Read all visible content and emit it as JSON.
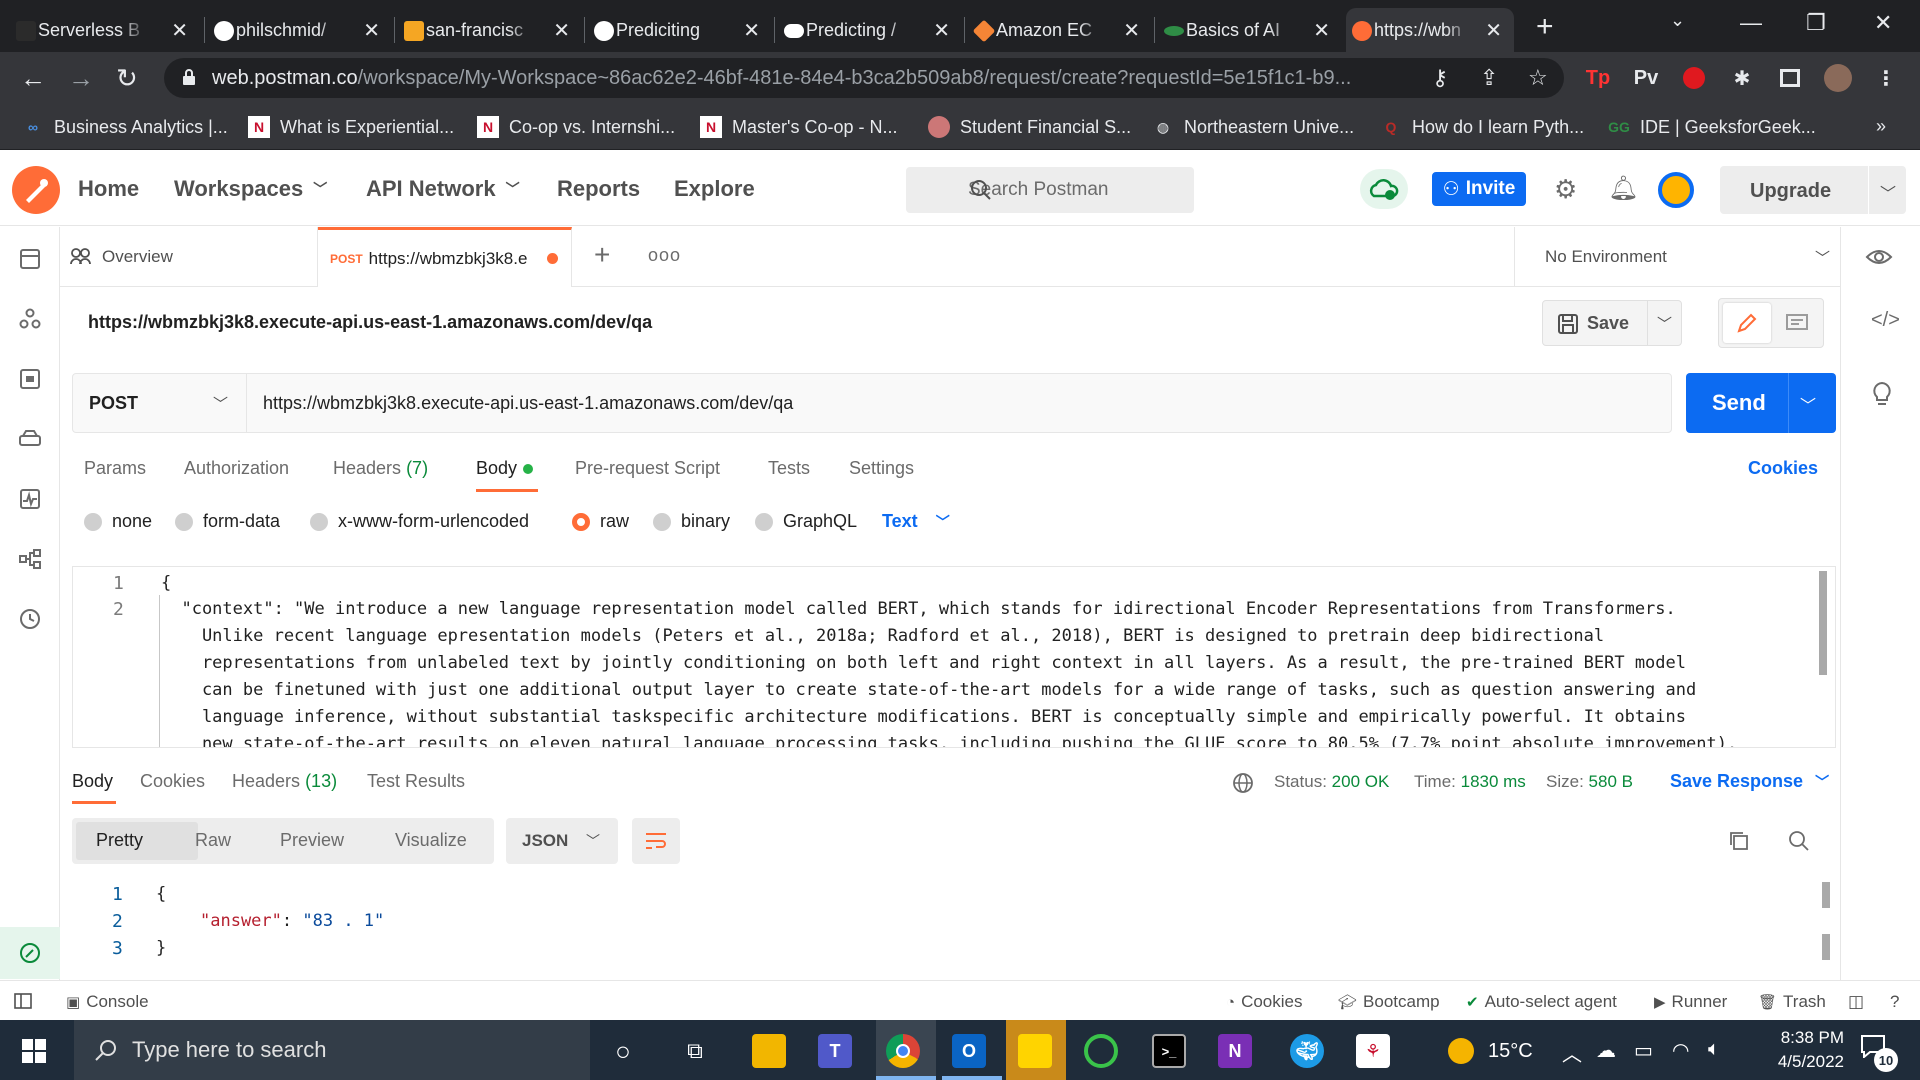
{
  "browser": {
    "tabs": [
      {
        "label": "Serverless B",
        "icon": "serverless-icon",
        "color": "#e04b26"
      },
      {
        "label": "philschmid/",
        "icon": "github-icon",
        "color": "#ffffff"
      },
      {
        "label": "san-francisc",
        "icon": "book-icon",
        "color": "#f5a623"
      },
      {
        "label": "Prediciting",
        "icon": "github-icon",
        "color": "#ffffff"
      },
      {
        "label": "Predicting /",
        "icon": "medium-icon",
        "color": "#ffffff"
      },
      {
        "label": "Amazon EC",
        "icon": "aws-cube-icon",
        "color": "#f58536"
      },
      {
        "label": "Basics of AI",
        "icon": "geeksforgeeks-icon",
        "color": "#2f8d46"
      },
      {
        "label": "https://wbn",
        "icon": "postman-icon",
        "color": "#ff6c37",
        "active": true
      }
    ],
    "address": {
      "host": "web.postman.co",
      "path": "/workspace/My-Workspace~86ac62e2-46bf-481e-84e4-b3ca2b509ab8/request/create?requestId=5e15f1c1-b9..."
    },
    "extensions": [
      "Tp",
      "Pv"
    ],
    "bookmarks": [
      {
        "label": "Business Analytics |...",
        "icon": "infinity-icon"
      },
      {
        "label": "What is Experiential...",
        "icon": "northeastern-icon"
      },
      {
        "label": "Co-op vs. Internshi...",
        "icon": "northeastern-icon"
      },
      {
        "label": "Master's Co-op - N...",
        "icon": "northeastern-icon"
      },
      {
        "label": "Student Financial S...",
        "icon": "seal-icon"
      },
      {
        "label": "Northeastern Unive...",
        "icon": "globe-icon"
      },
      {
        "label": "How do I learn Pyth...",
        "icon": "quora-icon"
      },
      {
        "label": "IDE | GeeksforGeek...",
        "icon": "geeksforgeeks-icon"
      }
    ],
    "bookmarks_more": "»"
  },
  "postman": {
    "nav": {
      "home": "Home",
      "workspaces": "Workspaces",
      "api_network": "API Network",
      "reports": "Reports",
      "explore": "Explore"
    },
    "search_placeholder": "Search Postman",
    "invite": "Invite",
    "upgrade": "Upgrade",
    "tabs": {
      "overview": "Overview",
      "request_method": "POST",
      "request_label": "https://wbmzbkj3k8.e",
      "plus": "+",
      "more": "ooo"
    },
    "environment": "No Environment",
    "request_title": "https://wbmzbkj3k8.execute-api.us-east-1.amazonaws.com/dev/qa",
    "save": "Save",
    "method": "POST",
    "url": "https://wbmzbkj3k8.execute-api.us-east-1.amazonaws.com/dev/qa",
    "send": "Send",
    "request_tabs": {
      "params": "Params",
      "authorization": "Authorization",
      "headers": "Headers",
      "headers_count": "(7)",
      "body": "Body",
      "prerequest": "Pre-request Script",
      "tests": "Tests",
      "settings": "Settings",
      "cookies": "Cookies"
    },
    "body_types": {
      "none": "none",
      "form_data": "form-data",
      "urlencoded": "x-www-form-urlencoded",
      "raw": "raw",
      "binary": "binary",
      "graphql": "GraphQL",
      "format": "Text"
    },
    "body_lines": {
      "n1": "1",
      "n2": "2",
      "l1": "{",
      "l2": "  \"context\": \"We introduce a new language representation model called BERT, which stands for idirectional Encoder Representations from Transformers.",
      "l3": "    Unlike recent language epresentation models (Peters et al., 2018a; Radford et al., 2018), BERT is designed to pretrain deep bidirectional",
      "l4": "    representations from unlabeled text by jointly conditioning on both left and right context in all layers. As a result, the pre-trained BERT model",
      "l5": "    can be finetuned with just one additional output layer to create state-of-the-art models for a wide range of tasks, such as question answering and",
      "l6": "    language inference, without substantial taskspecific architecture modifications. BERT is conceptually simple and empirically powerful. It obtains",
      "l7": "    new state-of-the-art results on eleven natural language processing tasks, including pushing the GLUE score to 80.5% (7.7% point absolute improvement),"
    },
    "response": {
      "tabs": {
        "body": "Body",
        "cookies": "Cookies",
        "headers": "Headers",
        "headers_count": "(13)",
        "tests": "Test Results"
      },
      "status_label": "Status:",
      "status": "200 OK",
      "time_label": "Time:",
      "time": "1830 ms",
      "size_label": "Size:",
      "size": "580 B",
      "save_response": "Save Response",
      "views": {
        "pretty": "Pretty",
        "raw": "Raw",
        "preview": "Preview",
        "visualize": "Visualize"
      },
      "format": "JSON",
      "lines": {
        "n1": "1",
        "n2": "2",
        "n3": "3",
        "open": "{",
        "key": "\"answer\"",
        "colon": ": ",
        "value": "\"83 . 1\"",
        "close": "}"
      }
    },
    "statusbar": {
      "console": "Console",
      "cookies": "Cookies",
      "bootcamp": "Bootcamp",
      "auto_select": "Auto-select agent",
      "runner": "Runner",
      "trash": "Trash"
    }
  },
  "taskbar": {
    "search_placeholder": "Type here to search",
    "weather": "15°C",
    "time": "8:38 PM",
    "date": "4/5/2022",
    "notifications": "10"
  }
}
